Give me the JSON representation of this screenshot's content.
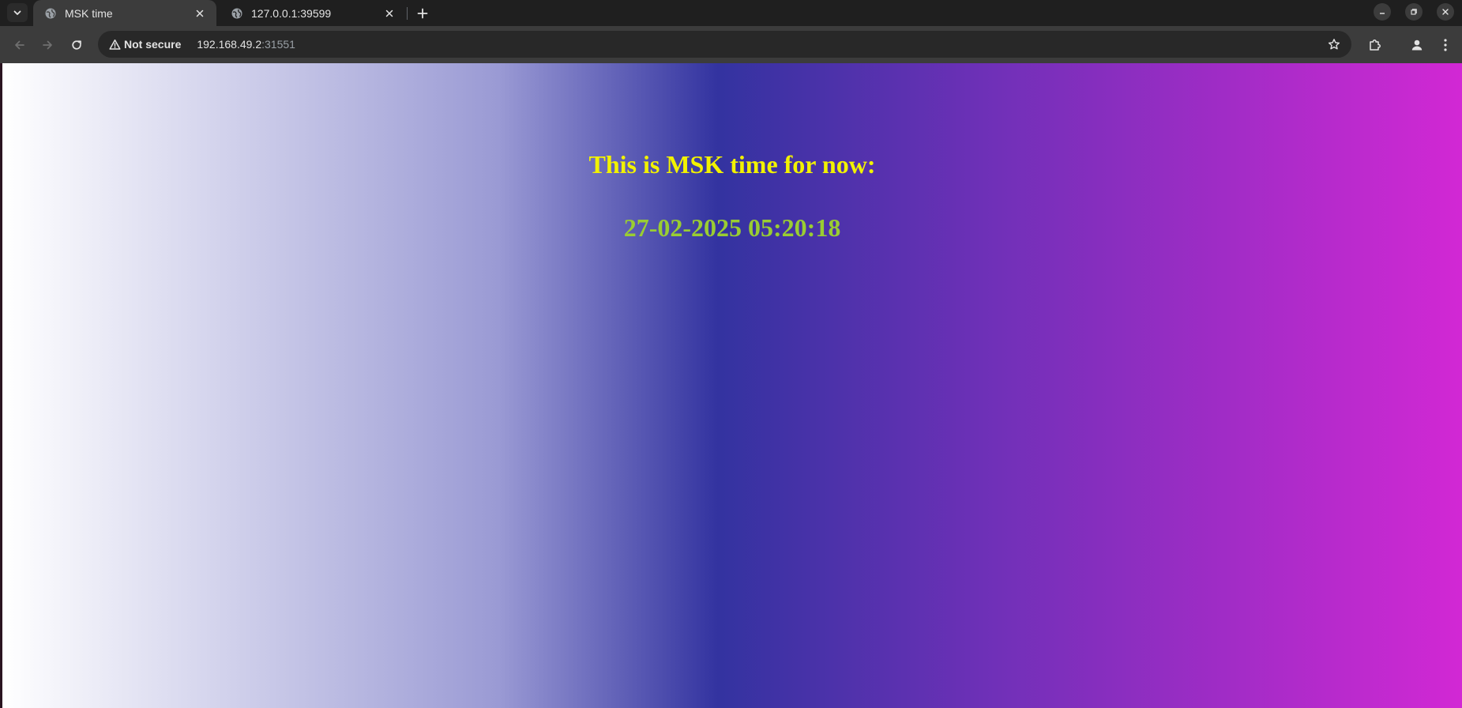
{
  "browser": {
    "tabs": [
      {
        "title": "MSK time",
        "active": true
      },
      {
        "title": "127.0.0.1:39599",
        "active": false
      }
    ],
    "toolbar": {
      "security_label": "Not secure",
      "url_host": "192.168.49.2",
      "url_port": ":31551"
    }
  },
  "page": {
    "heading": "This is MSK time for now:",
    "time": "27-02-2025 05:20:18"
  },
  "colors": {
    "heading": "#f2f200",
    "time": "#9acd32",
    "chrome_tabstrip": "#1f1f1f",
    "chrome_toolbar": "#3c3c3c",
    "omnibox": "#282828",
    "gradient": [
      "#ffffff",
      "#3333a0",
      "#d228d4"
    ]
  },
  "icons": {
    "tab_search": "chevron-down-icon",
    "favicon": "globe-icon",
    "tab_close": "close-icon",
    "new_tab": "plus-icon",
    "back": "arrow-left-icon",
    "forward": "arrow-right-icon",
    "reload": "reload-icon",
    "security": "warning-triangle-icon",
    "bookmark": "star-icon",
    "extensions": "puzzle-icon",
    "profile": "person-icon",
    "menu": "kebab-menu-icon",
    "minimize": "minimize-icon",
    "restore": "restore-icon",
    "close_window": "close-icon"
  }
}
